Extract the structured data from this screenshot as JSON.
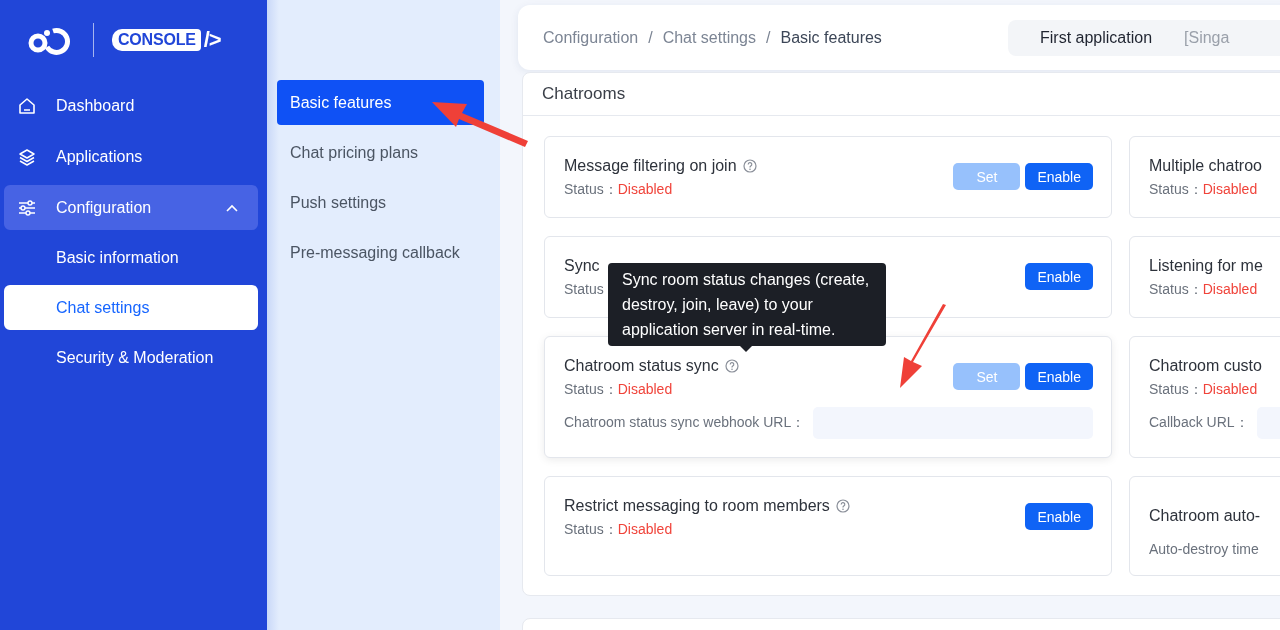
{
  "logo": {
    "wordmark": "CONSOLE",
    "code_mark": "/>"
  },
  "sidebar": {
    "items": [
      {
        "label": "Dashboard",
        "selected": false
      },
      {
        "label": "Applications",
        "selected": false
      },
      {
        "label": "Configuration",
        "selected": false,
        "expanded": true,
        "children": [
          {
            "label": "Basic information",
            "selected": false
          },
          {
            "label": "Chat settings",
            "selected": true
          },
          {
            "label": "Security & Moderation",
            "selected": false
          }
        ]
      }
    ]
  },
  "subnav": {
    "items": [
      {
        "label": "Basic features",
        "selected": true
      },
      {
        "label": "Chat pricing plans",
        "selected": false
      },
      {
        "label": "Push settings",
        "selected": false
      },
      {
        "label": "Pre-messaging callback",
        "selected": false
      }
    ]
  },
  "breadcrumb": {
    "separator": "/",
    "items": [
      "Configuration",
      "Chat settings",
      "Basic features"
    ]
  },
  "app_selector": {
    "name": "First application",
    "region": "[Singa"
  },
  "section": {
    "title": "Chatrooms",
    "cards": [
      {
        "kind": "feature",
        "title": "Message filtering on join",
        "help": true,
        "status_label": "Status：",
        "status": "Disabled",
        "buttons": [
          {
            "label": "Set",
            "disabled": true
          },
          {
            "label": "Enable",
            "disabled": false
          }
        ]
      },
      {
        "kind": "feature",
        "title": "Multiple chatroo",
        "status_label": "Status：",
        "status": "Disabled"
      },
      {
        "kind": "feature",
        "title": "Sync",
        "status_label": "Status",
        "buttons": [
          {
            "label": "Enable",
            "disabled": false
          }
        ]
      },
      {
        "kind": "feature",
        "title": "Listening for me",
        "status_label": "Status：",
        "status": "Disabled"
      },
      {
        "kind": "feature",
        "title": "Chatroom status sync",
        "help": true,
        "status_label": "Status：",
        "status": "Disabled",
        "buttons": [
          {
            "label": "Set",
            "disabled": true
          },
          {
            "label": "Enable",
            "disabled": false
          }
        ],
        "field_label": "Chatroom status sync webhook URL：",
        "tooltip": "Sync room status changes (create, destroy, join, leave) to your application server in real-time."
      },
      {
        "kind": "feature",
        "title": "Chatroom custo",
        "status_label": "Status：",
        "status": "Disabled",
        "field_label": "Callback URL："
      },
      {
        "kind": "feature",
        "title": "Restrict messaging to room members",
        "help": true,
        "status_label": "Status：",
        "status": "Disabled",
        "buttons": [
          {
            "label": "Enable",
            "disabled": false
          }
        ]
      },
      {
        "kind": "note",
        "title": "Chatroom auto-",
        "note": "Auto-destroy time"
      }
    ]
  }
}
